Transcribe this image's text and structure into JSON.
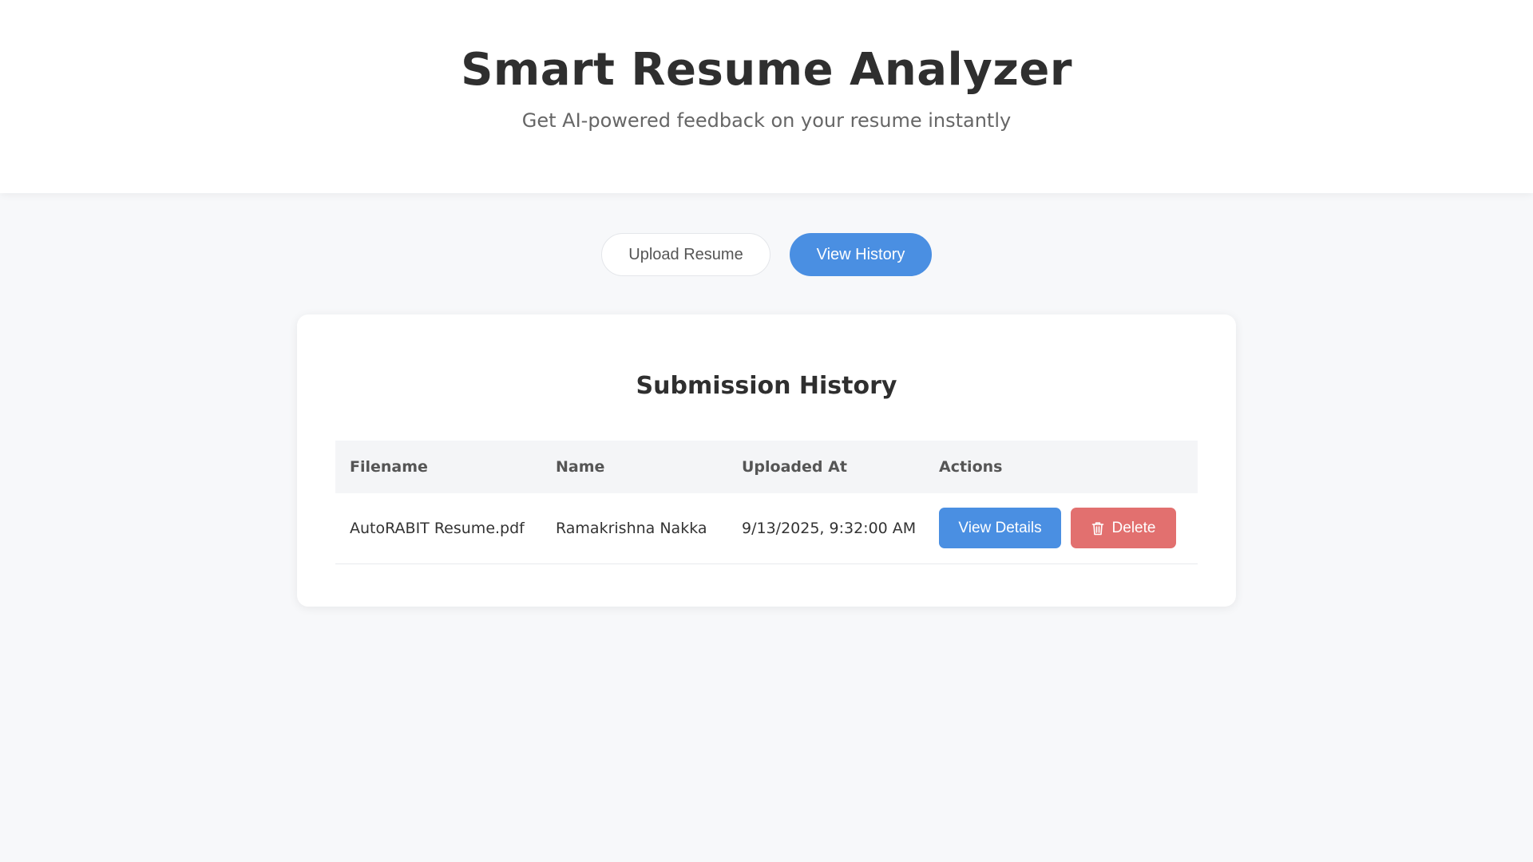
{
  "header": {
    "title": "Smart Resume Analyzer",
    "subtitle": "Get AI-powered feedback on your resume instantly"
  },
  "tabs": [
    {
      "label": "Upload Resume",
      "active": false
    },
    {
      "label": "View History",
      "active": true
    }
  ],
  "history": {
    "title": "Submission History",
    "columns": [
      "Filename",
      "Name",
      "Uploaded At",
      "Actions"
    ],
    "rows": [
      {
        "filename": "AutoRABIT Resume.pdf",
        "name": "Ramakrishna Nakka",
        "uploaded_at": "9/13/2025, 9:32:00 AM",
        "view_label": "View Details",
        "delete_label": "Delete",
        "delete_icon": "trash-icon"
      }
    ]
  },
  "colors": {
    "primary": "#4a8fe2",
    "danger": "#e2706f",
    "background": "#f7f8fa"
  }
}
